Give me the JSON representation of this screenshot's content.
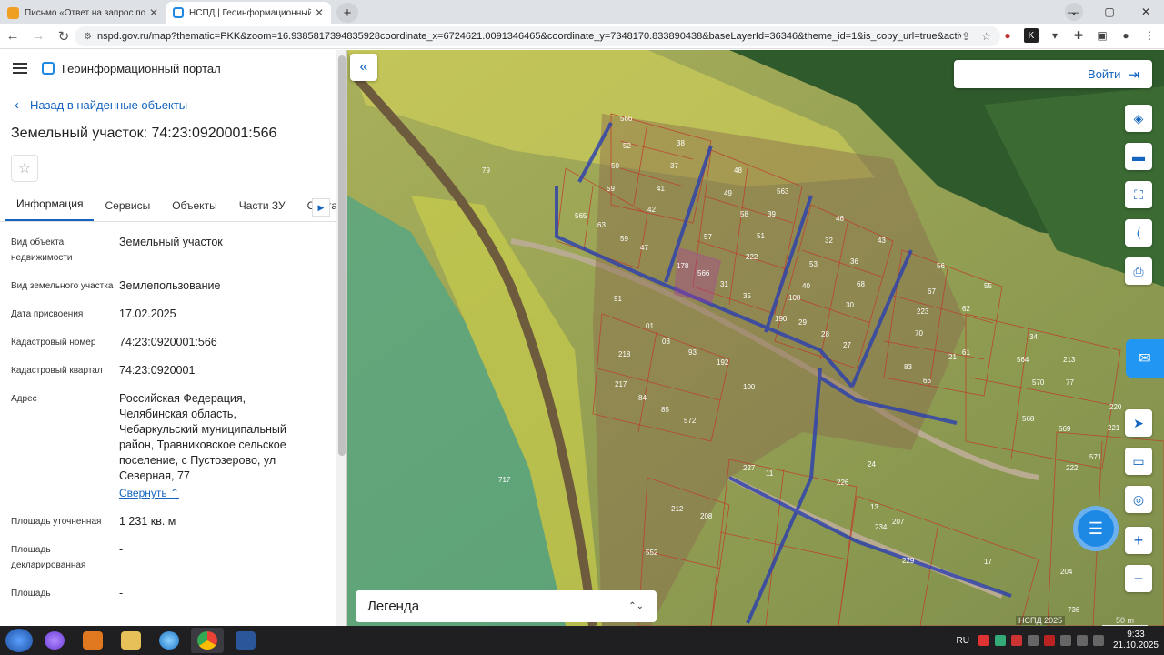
{
  "browser": {
    "tabs": [
      {
        "title": "Письмо «Ответ на запрос по Р..."
      },
      {
        "title": "НСПД | Геоинформационный п..."
      }
    ],
    "url": "nspd.gov.ru/map?thematic=PKK&zoom=16.9385817394835928coordinate_x=6724621.0091346465&coordinate_y=7348170.833890438&baseLayerId=36346&theme_id=1&is_copy_url=true&active..."
  },
  "sidebar": {
    "portal_name": "Геоинформационный портал",
    "back_label": "Назад в найденные объекты",
    "title": "Земельный участок: 74:23:0920001:566",
    "tabs": [
      "Информация",
      "Сервисы",
      "Объекты",
      "Части ЗУ",
      "Соста"
    ],
    "props": [
      {
        "key": "Вид объекта недвижимости",
        "value": "Земельный участок"
      },
      {
        "key": "Вид земельного участка",
        "value": "Землепользование"
      },
      {
        "key": "Дата присвоения",
        "value": "17.02.2025"
      },
      {
        "key": "Кадастровый номер",
        "value": "74:23:0920001:566"
      },
      {
        "key": "Кадастровый квартал",
        "value": "74:23:0920001"
      },
      {
        "key": "Адрес",
        "value": "Российская Федерация, Челябинская область, Чебаркульский муниципальный район, Травниковское сельское поселение, с Пустозерово, ул Северная, 77"
      },
      {
        "key": "Площадь уточненная",
        "value": "1 231 кв. м"
      },
      {
        "key": "Площадь декларированная",
        "value": "-"
      },
      {
        "key": "Площадь",
        "value": "-"
      }
    ],
    "collapse_label": "Свернуть"
  },
  "map": {
    "login_label": "Войти",
    "legend_label": "Легенда",
    "copyright": "НСПД 2025",
    "scale": "50 m",
    "lot_labels": [
      "566",
      "52",
      "38",
      "50",
      "37",
      "59",
      "41",
      "42",
      "565",
      "63",
      "59",
      "47",
      "48",
      "49",
      "563",
      "58",
      "39",
      "57",
      "51",
      "178",
      "566",
      "222",
      "31",
      "35",
      "46",
      "32",
      "43",
      "53",
      "36",
      "40",
      "68",
      "108",
      "30",
      "190",
      "29",
      "28",
      "27",
      "67",
      "56",
      "55",
      "223",
      "62",
      "70",
      "61",
      "91",
      "01",
      "218",
      "03",
      "93",
      "192",
      "217",
      "84",
      "85",
      "572",
      "100",
      "21",
      "564",
      "34",
      "213",
      "570",
      "77",
      "568",
      "569",
      "220",
      "221",
      "571",
      "222",
      "227",
      "24",
      "11",
      "226",
      "13",
      "234",
      "207",
      "208",
      "212",
      "552",
      "229",
      "17",
      "204",
      "736",
      "717",
      "79",
      "83",
      "66"
    ]
  },
  "taskbar": {
    "lang": "RU",
    "time": "9:33",
    "date": "21.10.2025"
  }
}
